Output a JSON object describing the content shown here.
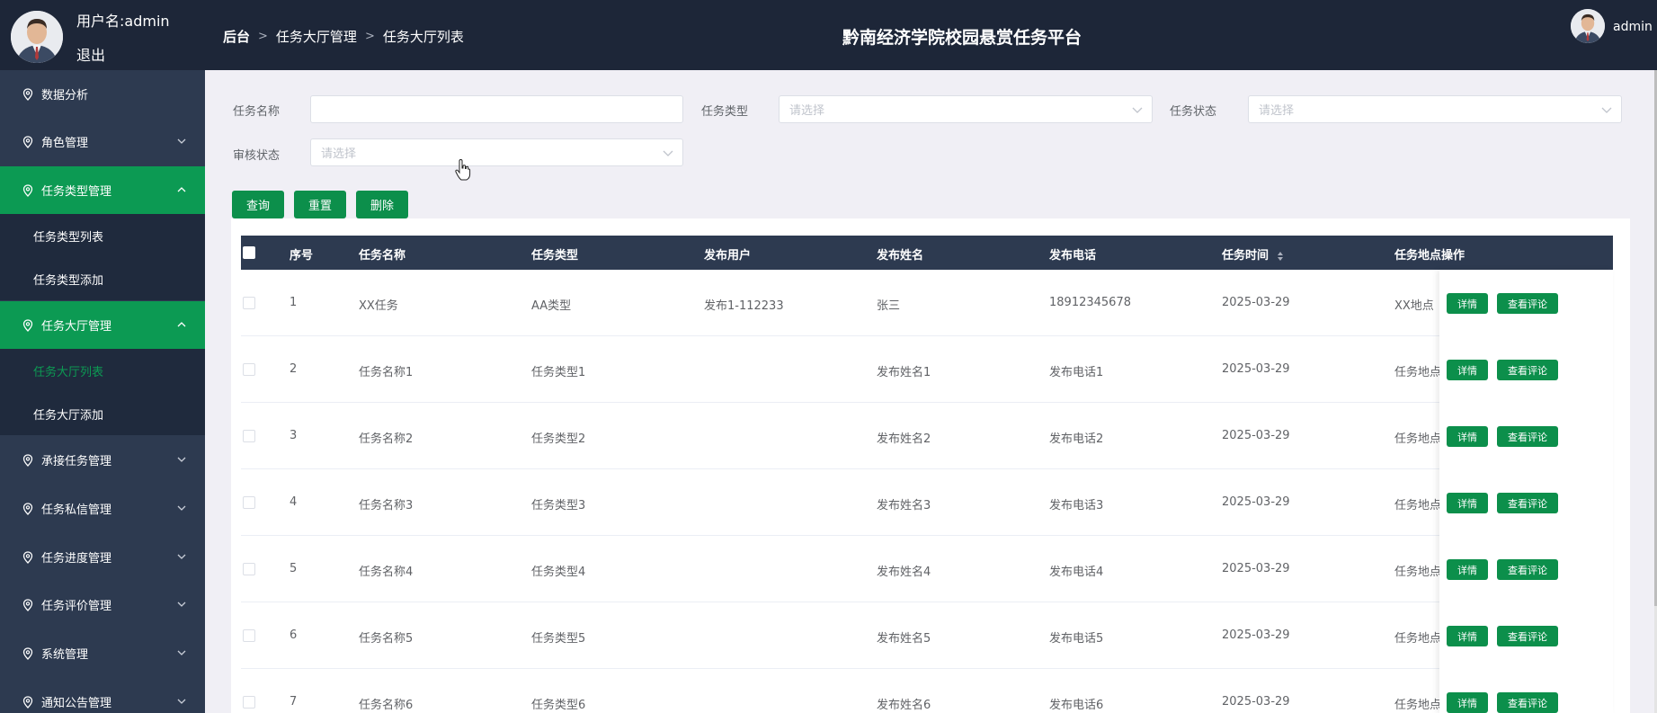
{
  "header": {
    "user_label": "用户名:admin",
    "logout": "退出",
    "breadcrumb": [
      "后台",
      "任务大厅管理",
      "任务大厅列表"
    ],
    "site_title": "黔南经济学院校园悬赏任务平台",
    "top_user": "admin"
  },
  "sidebar": {
    "items": [
      {
        "label": "数据分析"
      },
      {
        "label": "角色管理"
      },
      {
        "label": "任务类型管理"
      },
      {
        "label": "任务类型列表"
      },
      {
        "label": "任务类型添加"
      },
      {
        "label": "任务大厅管理"
      },
      {
        "label": "任务大厅列表"
      },
      {
        "label": "任务大厅添加"
      },
      {
        "label": "承接任务管理"
      },
      {
        "label": "任务私信管理"
      },
      {
        "label": "任务进度管理"
      },
      {
        "label": "任务评价管理"
      },
      {
        "label": "系统管理"
      },
      {
        "label": "通知公告管理"
      }
    ]
  },
  "search": {
    "task_name_label": "任务名称",
    "task_name_value": "",
    "task_type_label": "任务类型",
    "task_type_placeholder": "请选择",
    "task_status_label": "任务状态",
    "task_status_placeholder": "请选择",
    "audit_status_label": "审核状态",
    "audit_status_placeholder": "请选择"
  },
  "actions": {
    "query": "查询",
    "reset": "重置",
    "delete": "删除"
  },
  "table": {
    "headers": [
      "序号",
      "任务名称",
      "任务类型",
      "发布用户",
      "发布姓名",
      "发布电话",
      "任务时间",
      "任务地点",
      "操作"
    ],
    "detail_label": "详情",
    "comment_label": "查看评论",
    "rows": [
      {
        "no": "1",
        "name": "XX任务",
        "type": "AA类型",
        "user": "发布1-112233",
        "publisher": "张三",
        "phone": "18912345678",
        "time": "2025-03-29",
        "place": "XX地点"
      },
      {
        "no": "2",
        "name": "任务名称1",
        "type": "任务类型1",
        "user": "",
        "publisher": "发布姓名1",
        "phone": "发布电话1",
        "time": "2025-03-29",
        "place": "任务地点"
      },
      {
        "no": "3",
        "name": "任务名称2",
        "type": "任务类型2",
        "user": "",
        "publisher": "发布姓名2",
        "phone": "发布电话2",
        "time": "2025-03-29",
        "place": "任务地点"
      },
      {
        "no": "4",
        "name": "任务名称3",
        "type": "任务类型3",
        "user": "",
        "publisher": "发布姓名3",
        "phone": "发布电话3",
        "time": "2025-03-29",
        "place": "任务地点"
      },
      {
        "no": "5",
        "name": "任务名称4",
        "type": "任务类型4",
        "user": "",
        "publisher": "发布姓名4",
        "phone": "发布电话4",
        "time": "2025-03-29",
        "place": "任务地点"
      },
      {
        "no": "6",
        "name": "任务名称5",
        "type": "任务类型5",
        "user": "",
        "publisher": "发布姓名5",
        "phone": "发布电话5",
        "time": "2025-03-29",
        "place": "任务地点"
      },
      {
        "no": "7",
        "name": "任务名称6",
        "type": "任务类型6",
        "user": "",
        "publisher": "发布姓名6",
        "phone": "发布电话6",
        "time": "2025-03-29",
        "place": "任务地点"
      }
    ]
  },
  "colors": {
    "header_bg": "#1d2638",
    "sidebar_bg": "#2d3a50",
    "accent_green": "#0c9a53",
    "page_bg": "#f0eff5"
  },
  "icons": [
    "location-pin-icon",
    "chevron-down-icon",
    "chevron-up-icon",
    "sort-icon",
    "pointer-cursor-icon"
  ]
}
